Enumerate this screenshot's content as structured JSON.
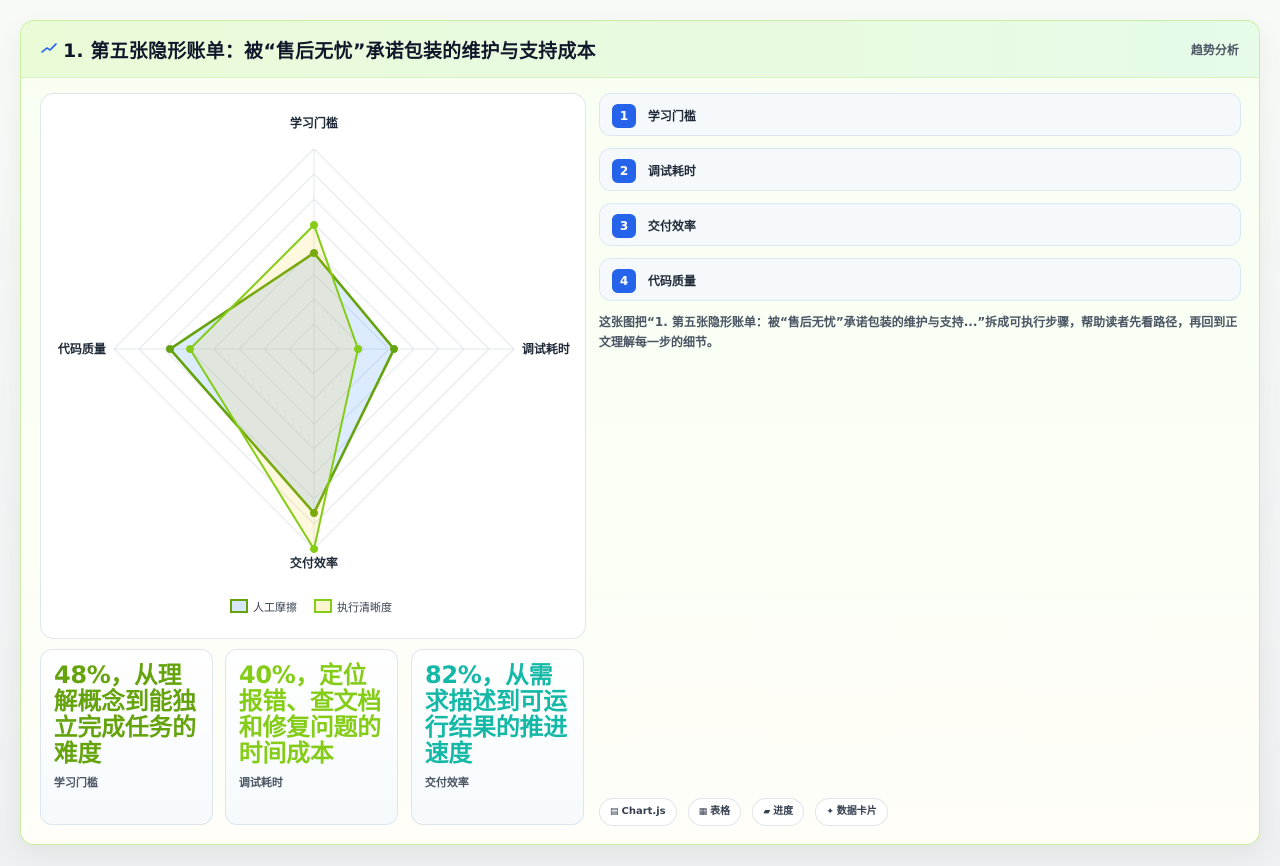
{
  "header": {
    "title": "1. 第五张隐形账单：被“售后无忧”承诺包装的维护与支持成本",
    "trend_label": "趋势分析"
  },
  "chart_data": {
    "type": "radar",
    "axes": [
      "学习门槛",
      "调试耗时",
      "交付效率",
      "代码质量"
    ],
    "rmax": 100,
    "series": [
      {
        "name": "人工摩擦",
        "values": [
          48,
          40,
          82,
          72
        ],
        "color": "#65a30d",
        "fill": "rgba(96,165,250,0.22)"
      },
      {
        "name": "执行清晰度",
        "values": [
          62,
          22,
          100,
          62
        ],
        "color": "#84cc16",
        "fill": "rgba(250,204,21,0.14)"
      }
    ]
  },
  "stats": [
    {
      "value": "48%，从理解概念到能独立完成任务的难度",
      "label": "学习门槛",
      "color": "#65a30d"
    },
    {
      "value": "40%，定位报错、查文档和修复问题的时间成本",
      "label": "调试耗时",
      "color": "#84cc16"
    },
    {
      "value": "82%，从需求描述到可运行结果的推进速度",
      "label": "交付效率",
      "color": "#14b8a6"
    }
  ],
  "steps": [
    {
      "num": "1",
      "label": "学习门槛"
    },
    {
      "num": "2",
      "label": "调试耗时"
    },
    {
      "num": "3",
      "label": "交付效率"
    },
    {
      "num": "4",
      "label": "代码质量"
    }
  ],
  "description": "这张图把“1. 第五张隐形账单：被“售后无忧”承诺包装的维护与支持...”拆成可执行步骤，帮助读者先看路径，再回到正文理解每一步的细节。",
  "tags": [
    {
      "icon": "chart-icon",
      "glyph": "▤",
      "label": "Chart.js"
    },
    {
      "icon": "table-icon",
      "glyph": "▦",
      "label": "表格"
    },
    {
      "icon": "progress-icon",
      "glyph": "▰",
      "label": "进度"
    },
    {
      "icon": "sparkle-icon",
      "glyph": "✦",
      "label": "数据卡片"
    }
  ]
}
